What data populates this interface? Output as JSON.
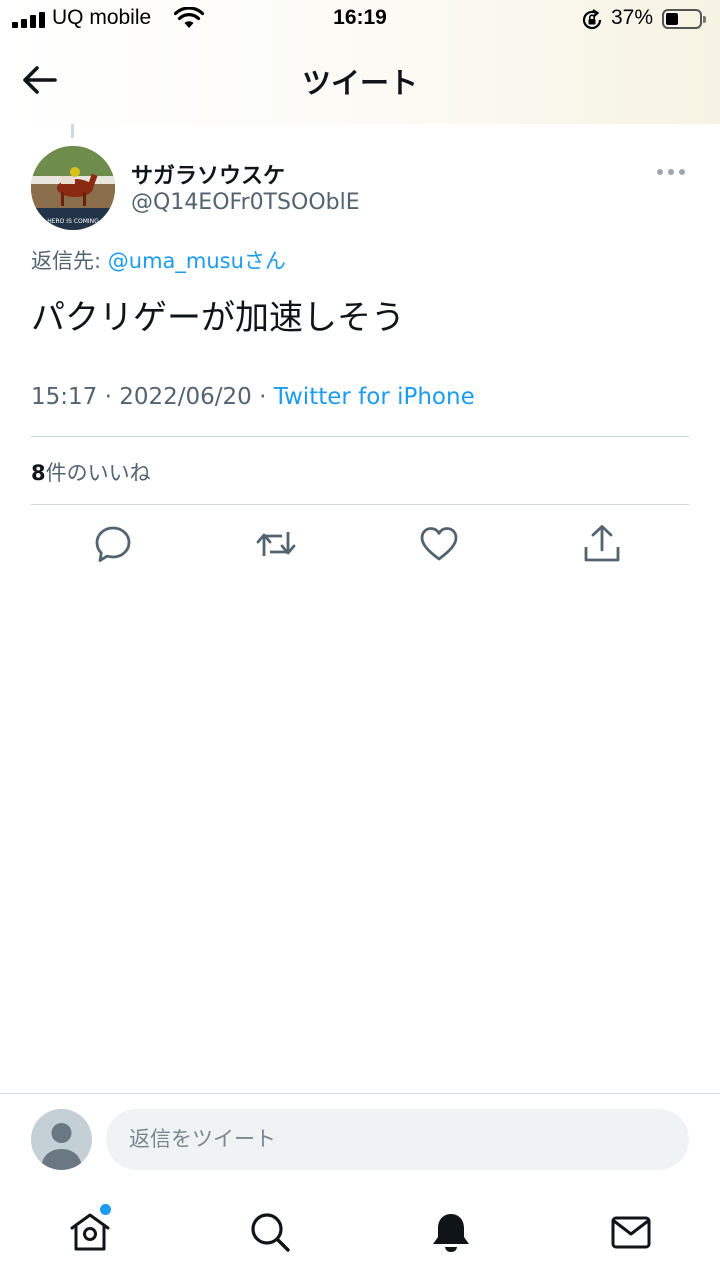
{
  "status_bar": {
    "carrier": "UQ mobile",
    "time": "16:19",
    "battery_percent": "37%",
    "battery_level": 0.37,
    "icons": [
      "signal-icon",
      "wifi-icon",
      "orientation-lock-icon",
      "battery-icon"
    ]
  },
  "header": {
    "title": "ツイート",
    "back_icon": "arrow-left-icon"
  },
  "tweet": {
    "display_name": "サガラソウスケ",
    "handle": "@Q14EOFr0TSOOblE",
    "reply_prefix": "返信先: ",
    "reply_to": "@uma_musuさん",
    "text": "パクリゲーが加速しそう",
    "time": "15:17",
    "separator": " · ",
    "date": "2022/06/20",
    "source": "Twitter for iPhone",
    "likes_count": "8",
    "likes_label": "件のいいね",
    "avatar_caption": "HERO IS COMING"
  },
  "actions": [
    "reply-icon",
    "retweet-icon",
    "like-icon",
    "share-icon"
  ],
  "reply_box": {
    "placeholder": "返信をツイート"
  },
  "tab_bar": {
    "tabs": [
      "home-icon",
      "search-icon",
      "notifications-icon",
      "messages-icon"
    ],
    "accent": "#1d9bf0"
  }
}
